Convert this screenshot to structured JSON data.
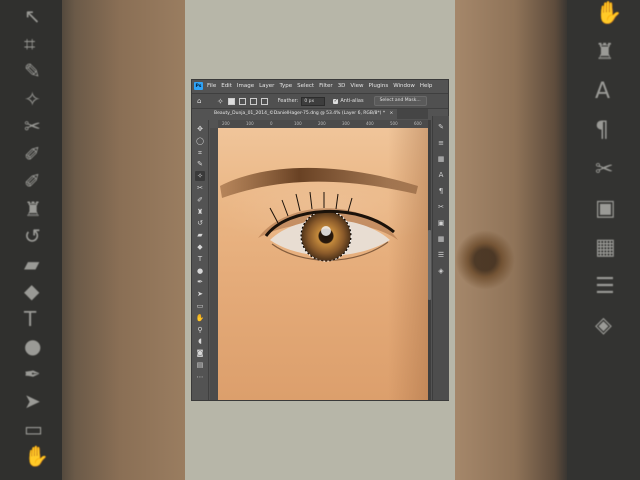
{
  "menu": {
    "app_badge": "Ps",
    "items": [
      "File",
      "Edit",
      "Image",
      "Layer",
      "Type",
      "Select",
      "Filter",
      "3D",
      "View",
      "Plugins",
      "Window",
      "Help"
    ]
  },
  "options": {
    "feather_label": "Feather:",
    "feather_value": "0 px",
    "anti_alias_label": "Anti-alias",
    "select_mask_label": "Select and Mask..."
  },
  "document": {
    "tab_title": "Beauty_Dunja_01_2014_©DanielHager-75.dng @ 53.4% (Layer 6, RGB/8*) *",
    "close": "×"
  },
  "ruler": {
    "h_ticks": [
      "200",
      "100",
      "0",
      "100",
      "200",
      "300",
      "400",
      "500",
      "600",
      "700"
    ]
  },
  "tools_left": [
    {
      "name": "move-tool-icon",
      "glyph": "✥"
    },
    {
      "name": "ellipse-marquee-tool-icon",
      "glyph": "◯"
    },
    {
      "name": "crop-tool-icon",
      "glyph": "⌗"
    },
    {
      "name": "eyedropper-tool-icon",
      "glyph": "✎"
    },
    {
      "name": "polygonal-lasso-tool-icon",
      "glyph": "✧"
    },
    {
      "name": "healing-brush-tool-icon",
      "glyph": "✂"
    },
    {
      "name": "brush-tool-icon",
      "glyph": "✐"
    },
    {
      "name": "clone-stamp-tool-icon",
      "glyph": "♜"
    },
    {
      "name": "history-brush-tool-icon",
      "glyph": "↺"
    },
    {
      "name": "eraser-tool-icon",
      "glyph": "▰"
    },
    {
      "name": "paint-bucket-tool-icon",
      "glyph": "◆"
    },
    {
      "name": "type-tool-icon",
      "glyph": "T"
    },
    {
      "name": "smudge-tool-icon",
      "glyph": "●"
    },
    {
      "name": "pen-tool-icon",
      "glyph": "✒"
    },
    {
      "name": "path-selection-tool-icon",
      "glyph": "➤"
    },
    {
      "name": "rectangle-tool-icon",
      "glyph": "▭"
    },
    {
      "name": "hand-tool-icon",
      "glyph": "✋"
    },
    {
      "name": "zoom-tool-icon",
      "glyph": "⚲"
    },
    {
      "name": "dodge-tool-icon",
      "glyph": "◖"
    },
    {
      "name": "quick-mask-icon",
      "glyph": "◙"
    },
    {
      "name": "screen-mode-icon",
      "glyph": "▤"
    },
    {
      "name": "edit-toolbar-icon",
      "glyph": "⋯"
    }
  ],
  "panel_right": [
    {
      "name": "brush-settings-panel-icon",
      "glyph": "✎"
    },
    {
      "name": "adjustments-panel-icon",
      "glyph": "≡"
    },
    {
      "name": "history-panel-icon",
      "glyph": "▦"
    },
    {
      "name": "character-panel-icon",
      "glyph": "A"
    },
    {
      "name": "paragraph-panel-icon",
      "glyph": "¶"
    },
    {
      "name": "tools-presets-panel-icon",
      "glyph": "✂"
    },
    {
      "name": "layer-comps-panel-icon",
      "glyph": "▣"
    },
    {
      "name": "swatches-panel-icon",
      "glyph": "▦"
    },
    {
      "name": "properties-panel-icon",
      "glyph": "☰"
    },
    {
      "name": "layers-panel-icon",
      "glyph": "◈"
    }
  ],
  "background_icons_left": [
    "↖",
    "⌗",
    "✎",
    "✧",
    "✂",
    "✐",
    "✐",
    "♜",
    "↺",
    "▰",
    "◆",
    "T",
    "●",
    "✒",
    "➤",
    "▭",
    "✋"
  ],
  "background_icons_right": [
    "✋",
    "♜",
    "A",
    "¶",
    "✂",
    "▣",
    "▦",
    "☰",
    "◈"
  ],
  "colors": {
    "ui_dark": "#535353",
    "ps_blue": "#2fa3f7",
    "skin": "#e4aa78",
    "iris": "#8a5a2a"
  }
}
